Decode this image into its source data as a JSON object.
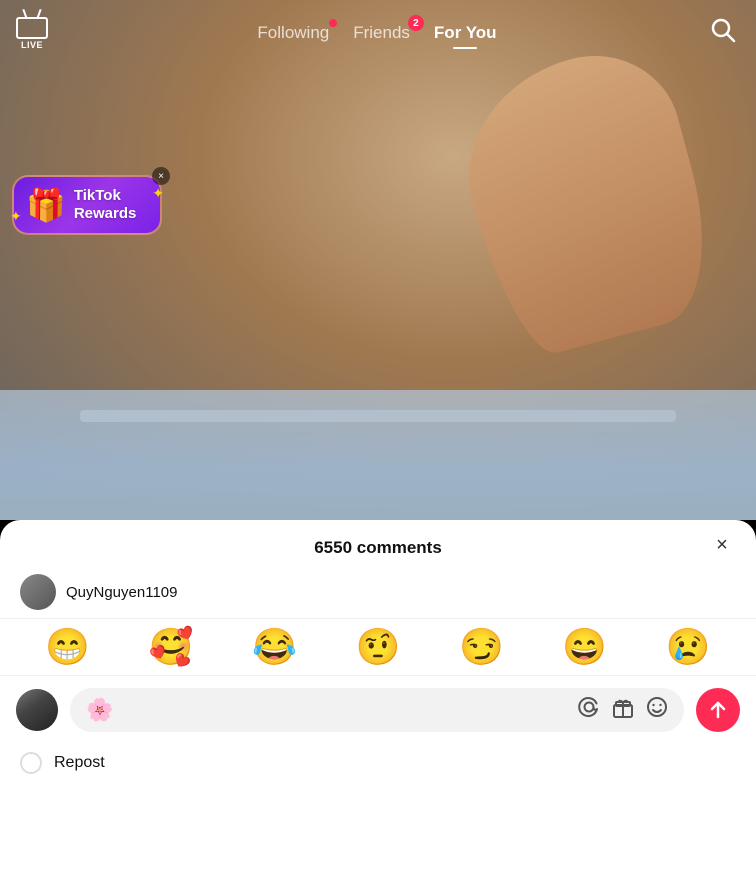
{
  "app": {
    "title": "TikTok",
    "colors": {
      "accent": "#fe2c55",
      "text_primary": "#111",
      "text_secondary": "#555",
      "bg_white": "#ffffff",
      "bg_gray": "#f2f2f2"
    }
  },
  "top_nav": {
    "live_label": "LIVE",
    "tabs": [
      {
        "id": "following",
        "label": "Following",
        "active": false,
        "dot": true,
        "badge": null
      },
      {
        "id": "friends",
        "label": "Friends",
        "active": false,
        "dot": false,
        "badge": "2"
      },
      {
        "id": "for_you",
        "label": "For You",
        "active": true,
        "dot": false,
        "badge": null
      }
    ],
    "search_icon": "search-icon"
  },
  "rewards_banner": {
    "title_line1": "TikTok",
    "title_line2": "Rewards",
    "close_label": "×",
    "emoji": "🎁"
  },
  "comments_section": {
    "header": "6550 comments",
    "close_icon": "×",
    "preview_username": "QuyNguyen1109",
    "emojis": [
      "😁",
      "🥰",
      "😂",
      "🤨",
      "😏",
      "😄",
      "😢"
    ],
    "input_placeholder": "",
    "input_emoji": "🌸",
    "at_icon": "@",
    "send_icon": "↑"
  },
  "repost": {
    "label": "Repost"
  }
}
